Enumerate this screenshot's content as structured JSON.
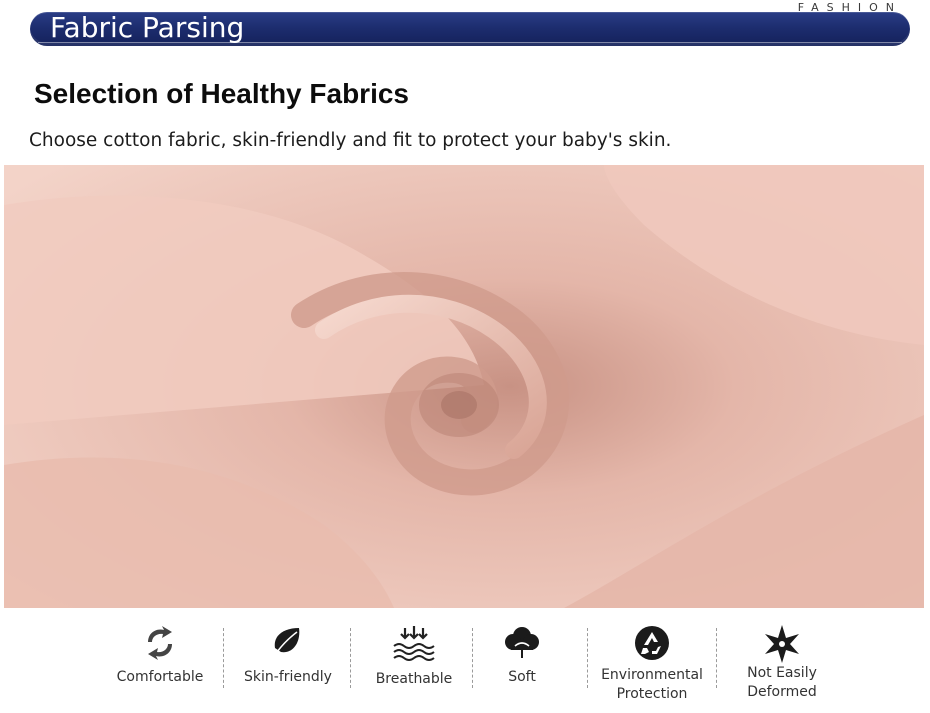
{
  "header": {
    "brand_label": "FASHION",
    "banner_title": "Fabric Parsing",
    "banner_color": "#1d2d6f"
  },
  "content": {
    "heading": "Selection of Healthy Fabrics",
    "subheading": "Choose cotton fabric, skin-friendly and fit to protect your baby's skin."
  },
  "photo": {
    "subject": "pink cotton fabric swirl",
    "base_color": "#ecc1b5"
  },
  "features": [
    {
      "icon": "recycle-arrows-icon",
      "label": "Comfortable"
    },
    {
      "icon": "leaf-icon",
      "label": "Skin-friendly"
    },
    {
      "icon": "breathable-waves-icon",
      "label": "Breathable"
    },
    {
      "icon": "cloud-icon",
      "label": "Soft"
    },
    {
      "icon": "recycle-icon",
      "label": "Environmental\nProtection"
    },
    {
      "icon": "star-icon",
      "label": "Not Easily\nDeformed"
    }
  ]
}
